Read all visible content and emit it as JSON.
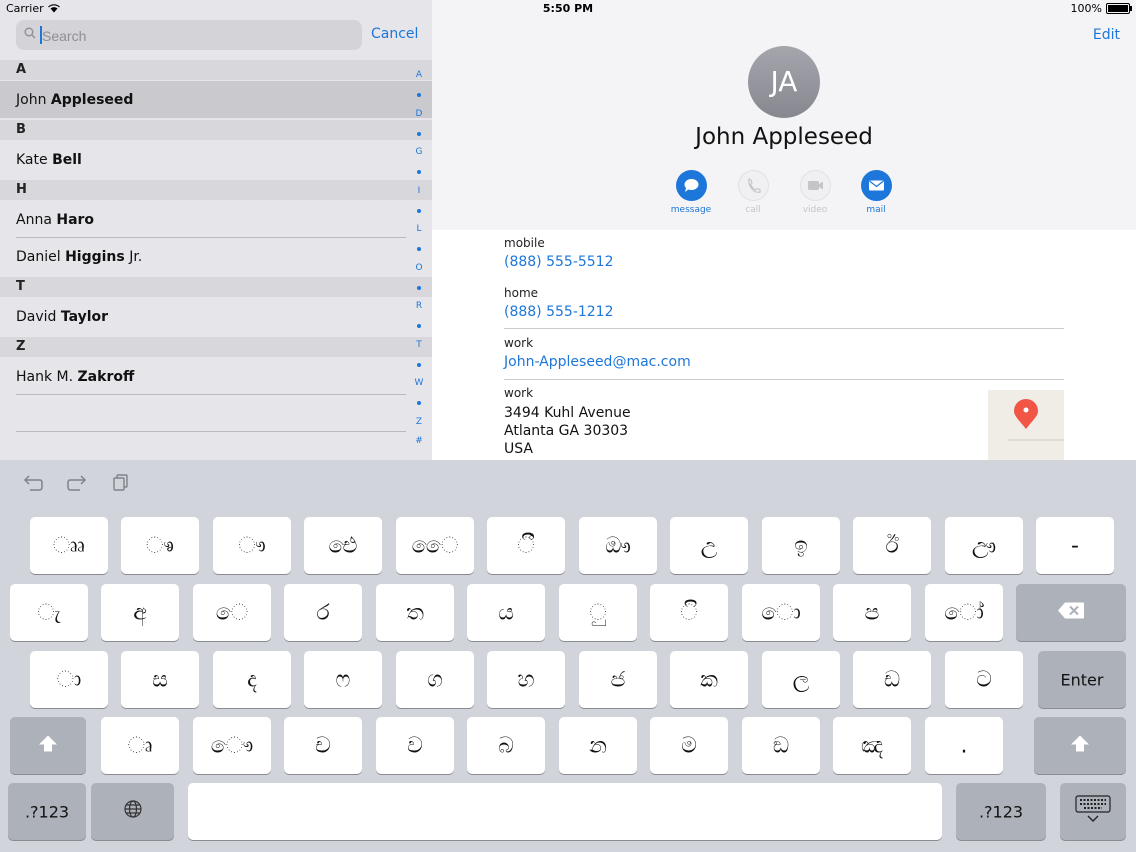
{
  "status": {
    "carrier": "Carrier",
    "time": "5:50 PM",
    "battery": "100%"
  },
  "search": {
    "placeholder": "Search",
    "cancel": "Cancel"
  },
  "contacts": {
    "sections": [
      "A",
      "B",
      "H",
      "T",
      "Z"
    ],
    "rows": [
      {
        "first": "John ",
        "last": "Appleseed",
        "suffix": ""
      },
      {
        "first": "Kate ",
        "last": "Bell",
        "suffix": ""
      },
      {
        "first": "Anna ",
        "last": "Haro",
        "suffix": ""
      },
      {
        "first": "Daniel ",
        "last": "Higgins",
        "suffix": " Jr."
      },
      {
        "first": "David ",
        "last": "Taylor",
        "suffix": ""
      },
      {
        "first": "Hank M. ",
        "last": "Zakroff",
        "suffix": ""
      }
    ],
    "index": [
      "A",
      "D",
      "G",
      "I",
      "L",
      "O",
      "R",
      "T",
      "W",
      "Z",
      "#"
    ]
  },
  "detail": {
    "edit": "Edit",
    "initials": "JA",
    "name": "John Appleseed",
    "actions": [
      {
        "label": "message",
        "icon": "message-icon",
        "enabled": true
      },
      {
        "label": "call",
        "icon": "phone-icon",
        "enabled": false
      },
      {
        "label": "video",
        "icon": "video-icon",
        "enabled": false
      },
      {
        "label": "mail",
        "icon": "mail-icon",
        "enabled": true
      }
    ],
    "fields": {
      "mobile_label": "mobile",
      "mobile_value": "(888) 555-5512",
      "home_label": "home",
      "home_value": "(888) 555-1212",
      "email_label": "work",
      "email_value": "John-Appleseed@mac.com",
      "address_label": "work",
      "street": "3494 Kuhl Avenue",
      "city": "Atlanta GA 30303",
      "country": "USA"
    }
  },
  "keyboard": {
    "row1": [
      "ෲ",
      "ෳ",
      "ෟ",
      "ඓ",
      "ෛ",
      "ී",
      "ඖ",
      "උ",
      "ඉ",
      "ඊ",
      "ඌ",
      "-"
    ],
    "row2": [
      "ැ",
      "අ",
      "ෙ",
      "ර",
      "ත",
      "ය",
      "ු",
      "ි",
      "ො",
      "ප",
      "ෝ"
    ],
    "row3": [
      "ා",
      "ස",
      "ද",
      "ෆ",
      "ග",
      "හ",
      "ජ",
      "ක",
      "ල",
      "ඩ",
      "ට"
    ],
    "row4": [
      "ෘ",
      "ෞ",
      "ච",
      "ව",
      "බ",
      "න",
      "ම",
      "ඞ",
      "ඤ",
      "."
    ],
    "enter": "Enter",
    "numbers": ".?123"
  },
  "colors": {
    "accent": "#1d76d9"
  }
}
